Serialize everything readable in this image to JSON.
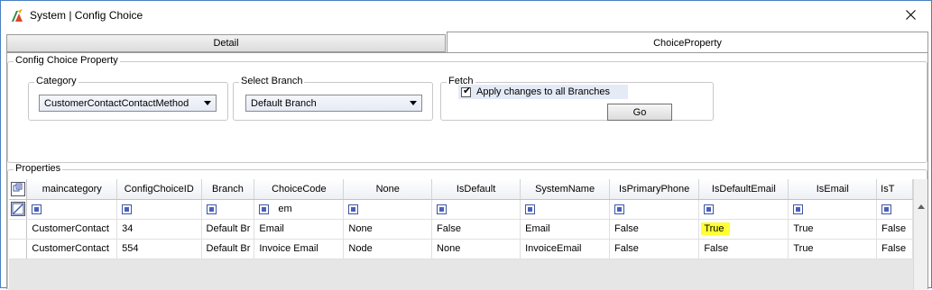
{
  "window": {
    "title": "System | Config Choice",
    "icon": "app-logo-icon",
    "close_icon": "close-icon"
  },
  "tabs": [
    {
      "label": "Detail",
      "selected": false
    },
    {
      "label": "ChoiceProperty",
      "selected": true
    }
  ],
  "config": {
    "legend": "Config Choice Property",
    "category": {
      "legend": "Category",
      "value": "CustomerContactContactMethod"
    },
    "branch": {
      "legend": "Select Branch",
      "value": "Default Branch"
    },
    "fetch": {
      "legend": "Fetch",
      "apply_label": "Apply changes to all Branches",
      "apply_checked": true,
      "go_label": "Go"
    }
  },
  "properties": {
    "legend": "Properties",
    "columns": [
      "maincategory",
      "ConfigChoiceID",
      "Branch",
      "ChoiceCode",
      "None",
      "IsDefault",
      "SystemName",
      "IsPrimaryPhone",
      "IsDefaultEmail",
      "IsEmail",
      "IsT"
    ],
    "filter_text": "em",
    "rows": [
      [
        "CustomerContact",
        "34",
        "Default Br",
        "Email",
        "None",
        "False",
        "Email",
        "False",
        "True",
        "True",
        "False"
      ],
      [
        "CustomerContact",
        "554",
        "Default Br",
        "Invoice Email",
        "Node",
        "None",
        "InvoiceEmail",
        "False",
        "False",
        "True",
        "False"
      ]
    ],
    "highlight_color": "#ffff33"
  },
  "colors": {
    "window_border": "#4a7fbf",
    "filter_icon": "#4b5fb8",
    "grid_background": "#e6e6e6"
  }
}
